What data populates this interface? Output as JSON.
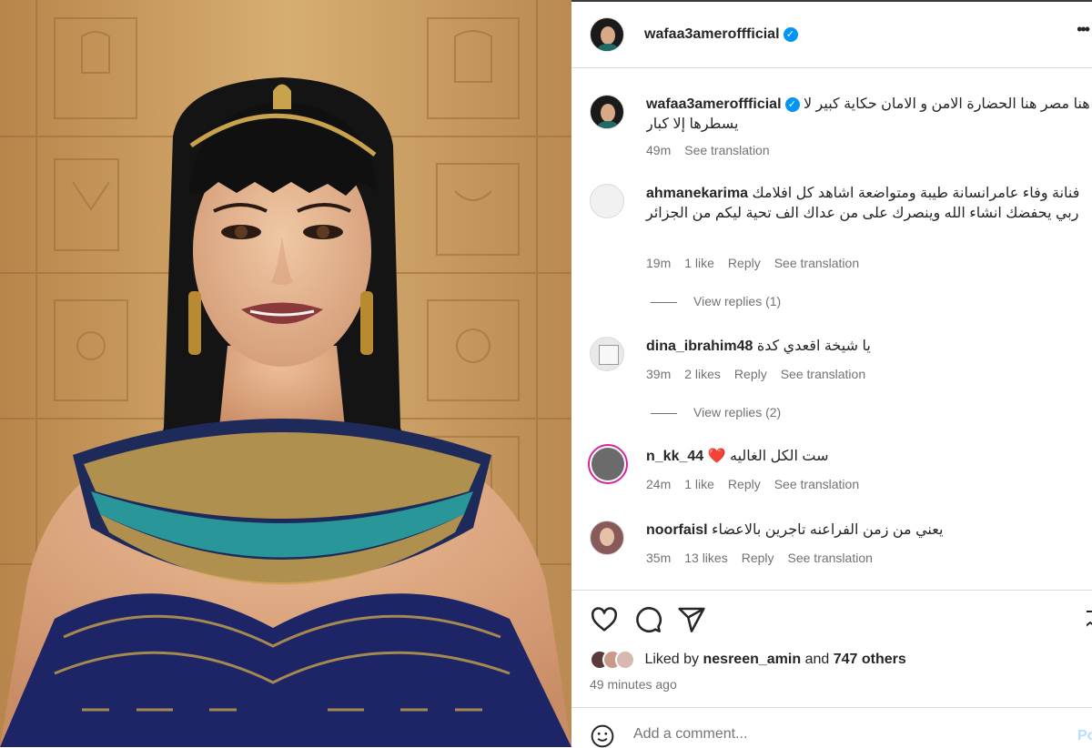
{
  "post": {
    "author": "wafaa3ameroffficial",
    "more_icon": "more-horizontal-icon",
    "verified_icon": "verified-badge-icon"
  },
  "caption": {
    "username": "wafaa3ameroffficial",
    "text": "هنا مصر هنا الحضارة الامن و الامان حكاية كبير لا يسطرها إلا كبار",
    "time": "49m",
    "translate": "See translation"
  },
  "comments": [
    {
      "username": "ahmanekarima",
      "text": "فنانة وفاء عامرانسانة طيبة ومتواضعة اشاهد كل افلامك ربي يحفضك انشاء الله وينصرك على من عداك الف تحية ليكم من الجزائر",
      "time": "19m",
      "likes": "1 like",
      "reply": "Reply",
      "translate": "See translation",
      "view_replies": "View replies (1)"
    },
    {
      "username": "dina_ibrahim48",
      "text": "يا شيخة اقعدي كدة",
      "time": "39m",
      "likes": "2 likes",
      "reply": "Reply",
      "translate": "See translation",
      "view_replies": "View replies (2)"
    },
    {
      "username": "n_kk_44",
      "text": "ست الكل الغاليه ❤️",
      "time": "24m",
      "likes": "1 like",
      "reply": "Reply",
      "translate": "See translation"
    },
    {
      "username": "noorfaisl",
      "text": "يعني من زمن الفراعنه تاجرين بالاعضاء",
      "time": "35m",
      "likes": "13 likes",
      "reply": "Reply",
      "translate": "See translation"
    }
  ],
  "actions": {
    "like_icon": "heart-icon",
    "comment_icon": "comment-icon",
    "share_icon": "send-icon",
    "save_icon": "bookmark-icon"
  },
  "likes": {
    "prefix": "Liked by",
    "user": "nesreen_amin",
    "and": "and",
    "others": "747 others"
  },
  "time_ago": "49 minutes ago",
  "add_comment": {
    "placeholder": "Add a comment...",
    "post_label": "Po",
    "emoji_icon": "emoji-icon"
  },
  "colors": {
    "verified": "#0095f6",
    "text": "#262626",
    "muted": "#737373",
    "divider": "#dbdbdb",
    "heart": "#ed1c24"
  }
}
